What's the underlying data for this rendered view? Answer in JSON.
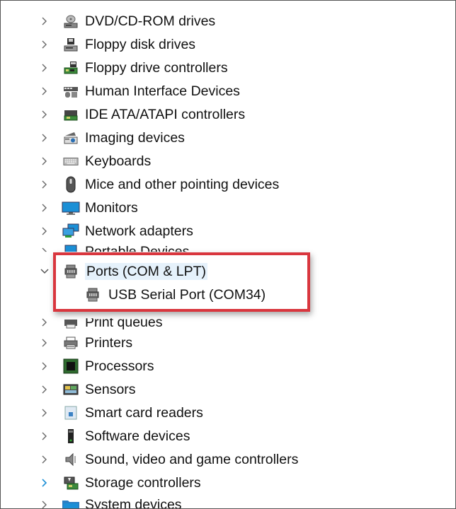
{
  "device_tree": {
    "items": [
      {
        "label": "DVD/CD-ROM drives",
        "icon": "dvd-drive-icon",
        "expanded": false
      },
      {
        "label": "Floppy disk drives",
        "icon": "floppy-disk-icon",
        "expanded": false
      },
      {
        "label": "Floppy drive controllers",
        "icon": "floppy-controller-icon",
        "expanded": false
      },
      {
        "label": "Human Interface Devices",
        "icon": "hid-icon",
        "expanded": false
      },
      {
        "label": "IDE ATA/ATAPI controllers",
        "icon": "ide-controller-icon",
        "expanded": false
      },
      {
        "label": "Imaging devices",
        "icon": "imaging-device-icon",
        "expanded": false
      },
      {
        "label": "Keyboards",
        "icon": "keyboard-icon",
        "expanded": false
      },
      {
        "label": "Mice and other pointing devices",
        "icon": "mouse-icon",
        "expanded": false
      },
      {
        "label": "Monitors",
        "icon": "monitor-icon",
        "expanded": false
      },
      {
        "label": "Network adapters",
        "icon": "network-adapter-icon",
        "expanded": false
      },
      {
        "label": "Portable Devices",
        "icon": "portable-device-icon",
        "expanded": false
      },
      {
        "label": "Ports (COM & LPT)",
        "icon": "port-icon",
        "expanded": true
      },
      {
        "label": "USB Serial Port (COM34)",
        "icon": "port-icon",
        "child": true
      },
      {
        "label": "Print queues",
        "icon": "print-queue-icon",
        "expanded": false
      },
      {
        "label": "Printers",
        "icon": "printer-icon",
        "expanded": false
      },
      {
        "label": "Processors",
        "icon": "processor-icon",
        "expanded": false
      },
      {
        "label": "Sensors",
        "icon": "sensor-icon",
        "expanded": false
      },
      {
        "label": "Smart card readers",
        "icon": "smart-card-reader-icon",
        "expanded": false
      },
      {
        "label": "Software devices",
        "icon": "software-device-icon",
        "expanded": false
      },
      {
        "label": "Sound, video and game controllers",
        "icon": "sound-controller-icon",
        "expanded": false
      },
      {
        "label": "Storage controllers",
        "icon": "storage-controller-icon",
        "expanded": false
      },
      {
        "label": "System devices",
        "icon": "system-device-icon",
        "expanded": false
      }
    ]
  },
  "colors": {
    "highlight_border": "#d9363e",
    "chevron": "#555555",
    "chevron_hover": "#1e90d6"
  }
}
